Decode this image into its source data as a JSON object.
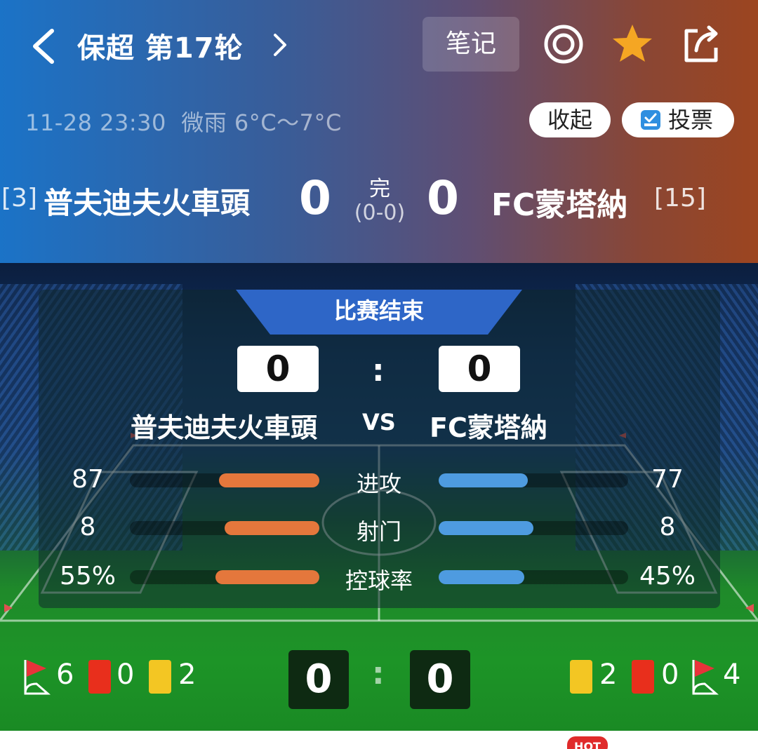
{
  "header": {
    "league_round": "保超 第17轮",
    "notes_label": "笔记",
    "datetime": "11-28 23:30",
    "weather": "微雨 6°C～7°C",
    "collapse_label": "收起",
    "vote_label": "投票"
  },
  "scoreboard": {
    "home_rank": "[3]",
    "home_team": "普夫迪夫火車頭",
    "home_score": "0",
    "status": "完",
    "half_time": "(0-0)",
    "away_score": "0",
    "away_team": "FC蒙塔納",
    "away_rank": "[15]"
  },
  "panel": {
    "result_label": "比赛结束",
    "home_score": "0",
    "colon": ":",
    "away_score": "0",
    "home_team": "普夫迪夫火車頭",
    "vs": "VS",
    "away_team": "FC蒙塔納",
    "stats": [
      {
        "label": "进攻",
        "home": "87",
        "away": "77",
        "home_fraction": 0.53,
        "away_fraction": 0.47
      },
      {
        "label": "射门",
        "home": "8",
        "away": "8",
        "home_fraction": 0.5,
        "away_fraction": 0.5
      },
      {
        "label": "控球率",
        "home": "55%",
        "away": "45%",
        "home_fraction": 0.55,
        "away_fraction": 0.45
      }
    ]
  },
  "bottom": {
    "home_corners": "6",
    "home_red": "0",
    "home_yellow": "2",
    "home_score": "0",
    "colon": ":",
    "away_score": "0",
    "away_yellow": "2",
    "away_red": "0",
    "away_corners": "4"
  },
  "hot_badge": "HOT",
  "colors": {
    "home_bar": "#e4773c",
    "away_bar": "#4e9be0",
    "star": "#f5a623",
    "banner": "#2e66c7"
  }
}
